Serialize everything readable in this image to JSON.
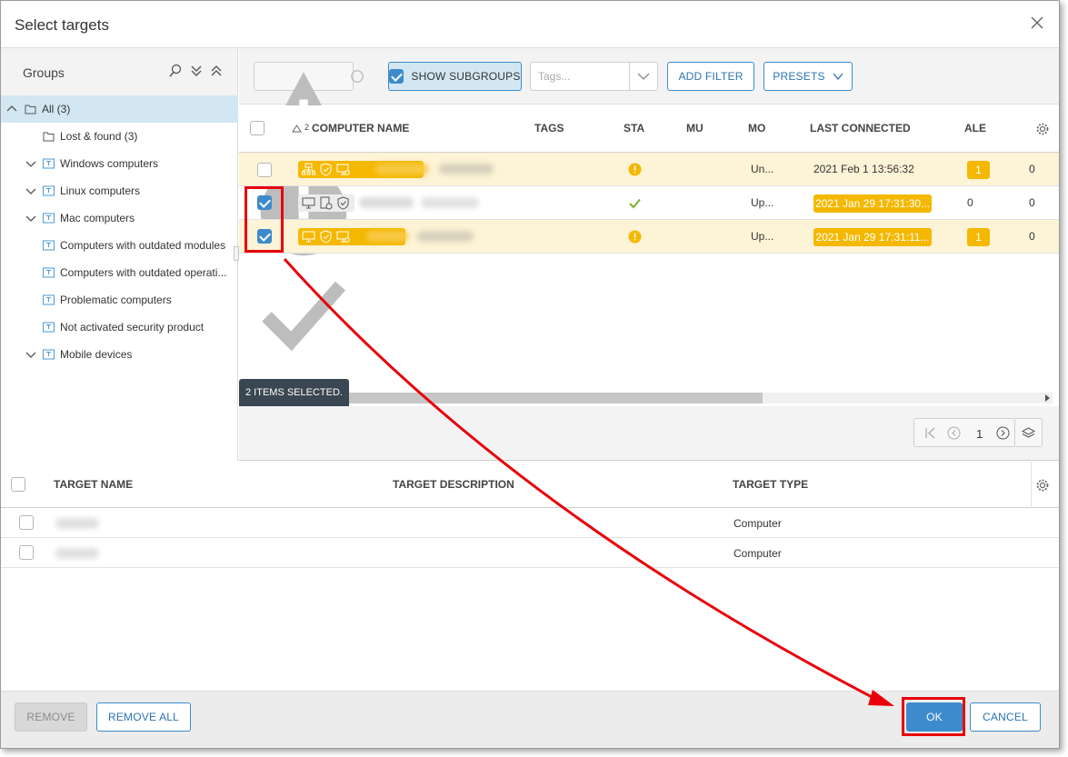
{
  "dialog": {
    "title": "Select targets"
  },
  "groups": {
    "title": "Groups",
    "items": [
      {
        "label": "All (3)"
      },
      {
        "label": "Lost & found (3)"
      },
      {
        "label": "Windows computers"
      },
      {
        "label": "Linux computers"
      },
      {
        "label": "Mac computers"
      },
      {
        "label": "Computers with outdated modules"
      },
      {
        "label": "Computers with outdated operati..."
      },
      {
        "label": "Problematic computers"
      },
      {
        "label": "Not activated security product"
      },
      {
        "label": "Mobile devices"
      }
    ]
  },
  "toolbar": {
    "show_subgroups": "SHOW SUBGROUPS",
    "tags_placeholder": "Tags...",
    "add_filter": "ADD FILTER",
    "presets": "PRESETS"
  },
  "computers_table": {
    "sort_index": "2",
    "columns": [
      "COMPUTER NAME",
      "TAGS",
      "STA",
      "MU",
      "MO",
      "LAST CONNECTED",
      "ALE"
    ],
    "rows": [
      {
        "status": "warning",
        "module": "Un...",
        "last_connected": "2021 Feb 1 13:56:32",
        "alerts": "1",
        "extra": "0",
        "checked": false
      },
      {
        "status": "ok",
        "module": "Up...",
        "last_connected": "2021 Jan 29 17:31:30...",
        "alerts": "0",
        "extra": "0",
        "checked": true
      },
      {
        "status": "warning",
        "module": "Up...",
        "last_connected": "2021 Jan 29 17:31:11...",
        "alerts": "1",
        "extra": "0",
        "checked": true
      }
    ],
    "selection_banner": "2 ITEMS SELECTED."
  },
  "pager": {
    "page": "1"
  },
  "target_table": {
    "columns": [
      "TARGET NAME",
      "TARGET DESCRIPTION",
      "TARGET TYPE"
    ],
    "rows": [
      {
        "type": "Computer"
      },
      {
        "type": "Computer"
      }
    ]
  },
  "footer": {
    "remove": "REMOVE",
    "remove_all": "REMOVE ALL",
    "ok": "OK",
    "cancel": "CANCEL"
  },
  "colors": {
    "accent": "#3d8bcd",
    "warning": "#f5b800",
    "warning_row": "#fdf3d6",
    "annotation": "#e8000b"
  }
}
